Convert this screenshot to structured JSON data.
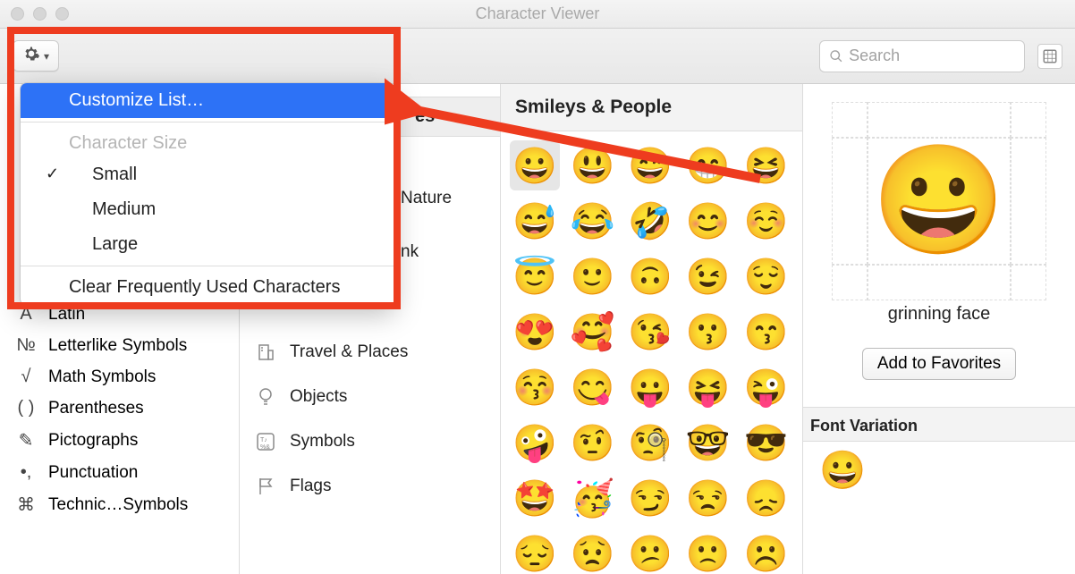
{
  "window": {
    "title": "Character Viewer"
  },
  "toolbar": {
    "search_placeholder": "Search"
  },
  "menu": {
    "customize": "Customize List…",
    "size_label": "Character Size",
    "small": "Small",
    "medium": "Medium",
    "large": "Large",
    "clear": "Clear Frequently Used Characters"
  },
  "sidebar": {
    "items": [
      {
        "icon": "A",
        "label": "Latin"
      },
      {
        "icon": "№",
        "label": "Letterlike Symbols"
      },
      {
        "icon": "√",
        "label": "Math Symbols"
      },
      {
        "icon": "( )",
        "label": "Parentheses"
      },
      {
        "icon": "✎",
        "label": "Pictographs"
      },
      {
        "icon": "•,",
        "label": "Punctuation"
      },
      {
        "icon": "⌘",
        "label": "Technic…Symbols"
      }
    ]
  },
  "categories": {
    "header_partial": "es",
    "items": [
      {
        "label": "Nature",
        "icon": "leaf-icon"
      },
      {
        "label": "nk",
        "icon": "food-icon"
      },
      {
        "label": "Travel & Places",
        "icon": "building-icon"
      },
      {
        "label": "Objects",
        "icon": "bulb-icon"
      },
      {
        "label": "Symbols",
        "icon": "symbols-icon"
      },
      {
        "label": "Flags",
        "icon": "flag-icon"
      }
    ]
  },
  "emoji": {
    "header": "Smileys & People",
    "grid": [
      "😀",
      "😃",
      "😄",
      "😁",
      "😆",
      "😅",
      "😂",
      "🤣",
      "😊",
      "☺️",
      "😇",
      "🙂",
      "🙃",
      "😉",
      "😌",
      "😍",
      "🥰",
      "😘",
      "😗",
      "😙",
      "😚",
      "😋",
      "😛",
      "😝",
      "😜",
      "🤪",
      "🤨",
      "🧐",
      "🤓",
      "😎",
      "🤩",
      "🥳",
      "😏",
      "😒",
      "😞",
      "😔",
      "😟",
      "😕",
      "🙁",
      "☹️"
    ]
  },
  "detail": {
    "name": "grinning face",
    "preview": "😀",
    "favorite_btn": "Add to Favorites",
    "variation_label": "Font Variation",
    "variation": "😀"
  }
}
